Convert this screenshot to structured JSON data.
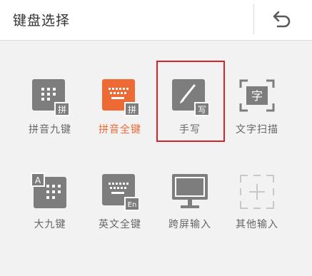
{
  "header": {
    "title": "键盘选择"
  },
  "items": [
    {
      "label": "拼音九键"
    },
    {
      "label": "拼音全键"
    },
    {
      "label": "手写"
    },
    {
      "label": "文字扫描"
    },
    {
      "label": "大九键"
    },
    {
      "label": "英文全键"
    },
    {
      "label": "跨屏输入"
    },
    {
      "label": "其他输入"
    }
  ],
  "badges": {
    "pinyin": "拼",
    "handwrite": "写",
    "scan": "字",
    "english": "En",
    "big9": "A"
  },
  "selected_index": 1,
  "colors": {
    "accent": "#ee6a35",
    "icon_gray": "#7d7d7d",
    "highlight": "#d8232a"
  }
}
